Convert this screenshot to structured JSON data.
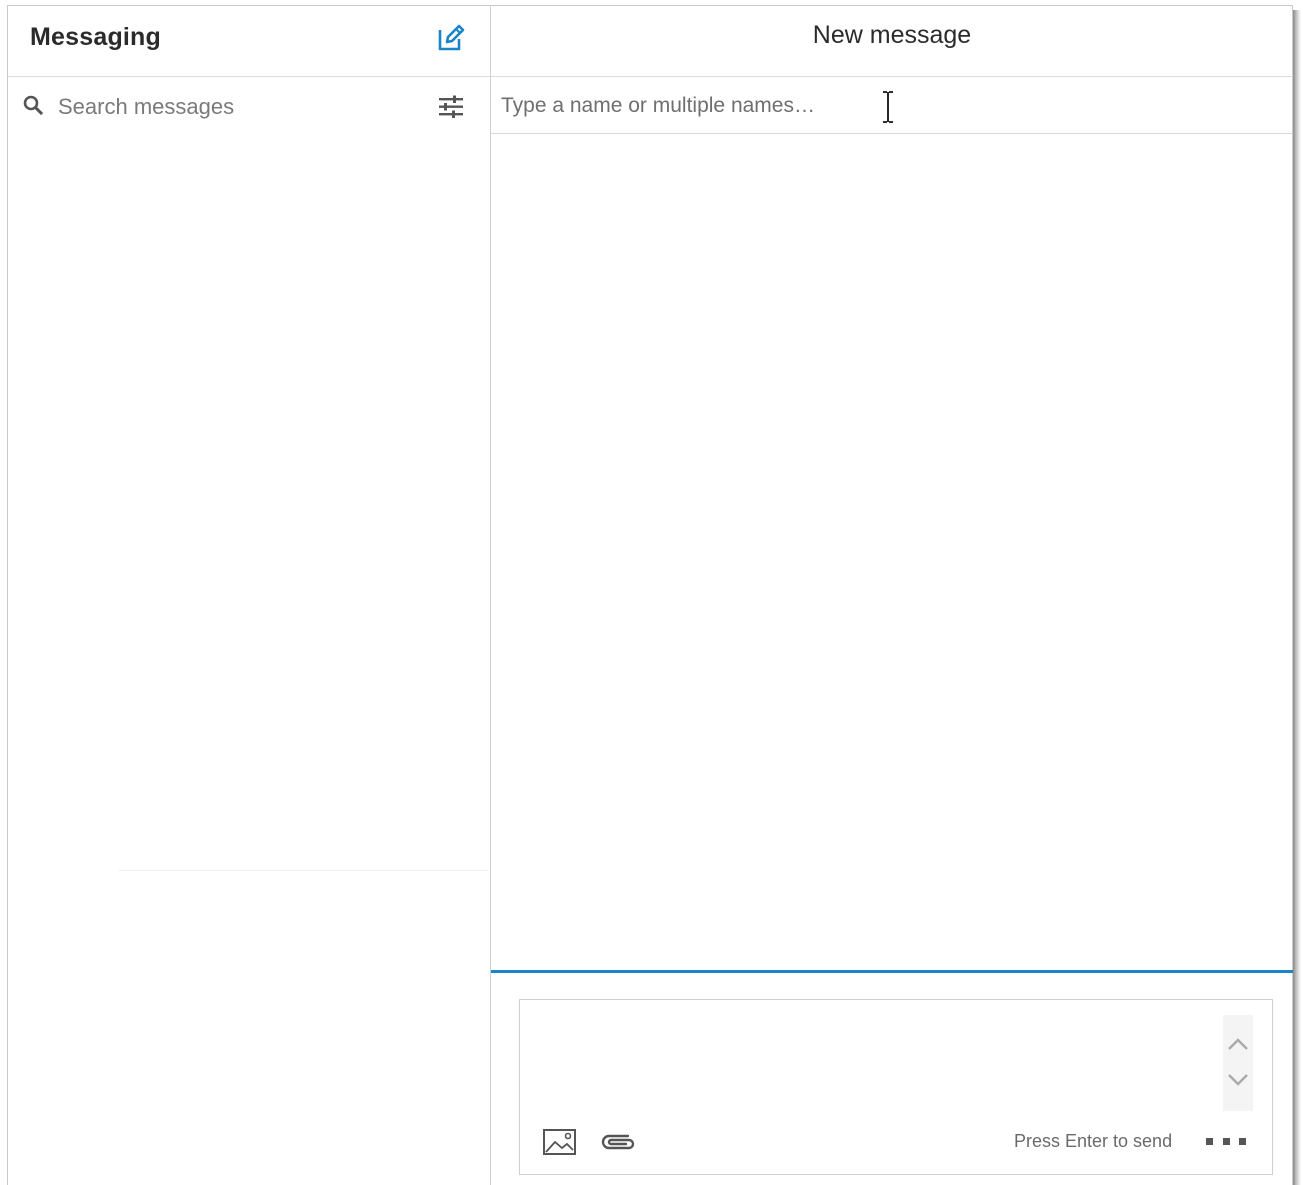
{
  "sidebar": {
    "title": "Messaging",
    "compose_icon": "compose-pencil-icon",
    "search": {
      "placeholder": "Search messages",
      "value": "",
      "icon": "search-icon"
    },
    "filter_icon": "filter-sliders-icon"
  },
  "conversation": {
    "title": "New message",
    "recipient": {
      "placeholder": "Type a name or multiple names…",
      "value": ""
    },
    "composer": {
      "value": "",
      "hint": "Press Enter to send",
      "image_icon": "image-icon",
      "attach_icon": "paperclip-icon",
      "more_icon": "more-options-icon",
      "scroll_up_icon": "chevron-up-icon",
      "scroll_down_icon": "chevron-down-icon"
    }
  },
  "colors": {
    "accent": "#1a84c7",
    "border": "#d0d0d0",
    "text": "#2b2b2b",
    "placeholder": "#7a7a7a"
  }
}
